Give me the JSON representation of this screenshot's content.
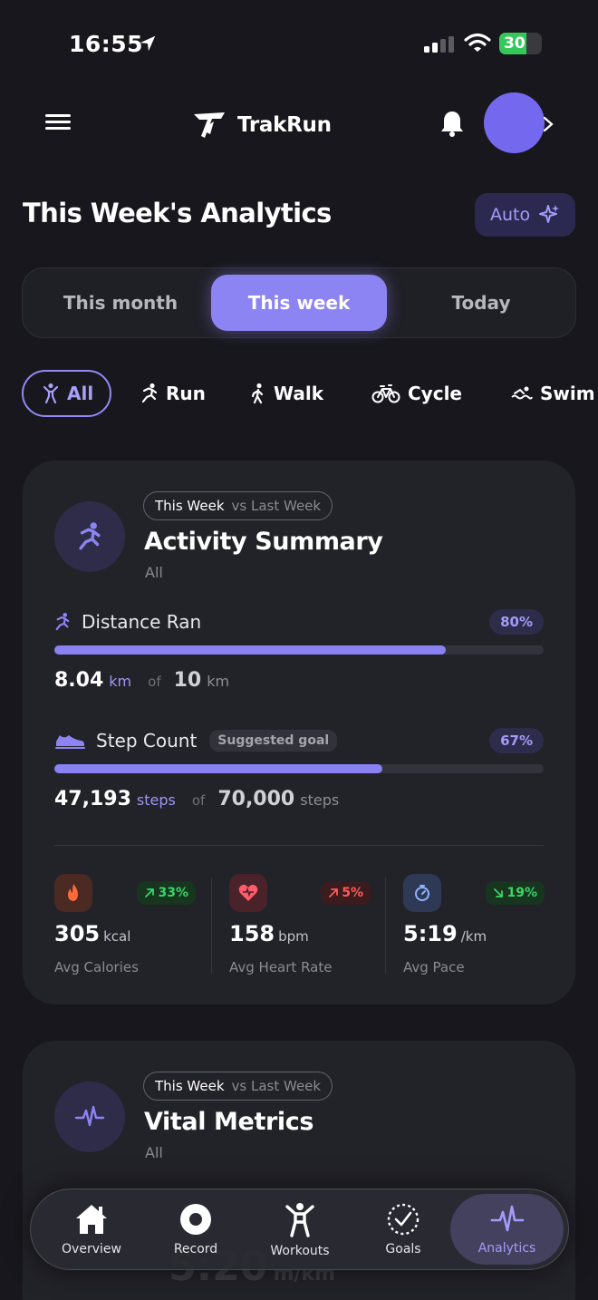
{
  "status": {
    "time": "16:55",
    "battery": "30"
  },
  "header": {
    "brand": "TrakRun"
  },
  "page": {
    "title": "This Week's Analytics",
    "auto_label": "Auto"
  },
  "periods": [
    "This month",
    "This week",
    "Today"
  ],
  "filters": [
    "All",
    "Run",
    "Walk",
    "Cycle",
    "Swim"
  ],
  "activity_card": {
    "compare_this": "This Week",
    "compare_vs": "vs Last Week",
    "title": "Activity Summary",
    "subtitle": "All",
    "distance": {
      "label": "Distance Ran",
      "percent": "80%",
      "progress": 0.8,
      "value": "8.04",
      "unit": "km",
      "of": "of",
      "goal": "10",
      "goal_unit": "km"
    },
    "steps": {
      "label": "Step Count",
      "tag": "Suggested goal",
      "percent": "67%",
      "progress": 0.67,
      "value": "47,193",
      "unit": "steps",
      "of": "of",
      "goal": "70,000",
      "goal_unit": "steps"
    },
    "stats": [
      {
        "trend": "33%",
        "value": "305",
        "unit": "kcal",
        "label": "Avg Calories"
      },
      {
        "trend": "5%",
        "value": "158",
        "unit": "bpm",
        "label": "Avg Heart Rate"
      },
      {
        "trend": "19%",
        "value": "5:19",
        "unit": "/km",
        "label": "Avg Pace"
      }
    ]
  },
  "vital_card": {
    "compare_this": "This Week",
    "compare_vs": "vs Last Week",
    "title": "Vital Metrics",
    "subtitle": "All"
  },
  "peek": {
    "value": "5:20",
    "unit": "m/km"
  },
  "nav": [
    "Overview",
    "Record",
    "Workouts",
    "Goals",
    "Analytics"
  ],
  "colors": {
    "accent": "#8d84f4",
    "background": "#17171d",
    "card": "#222229",
    "up": "#3ad566",
    "down": "#ff5b56"
  }
}
